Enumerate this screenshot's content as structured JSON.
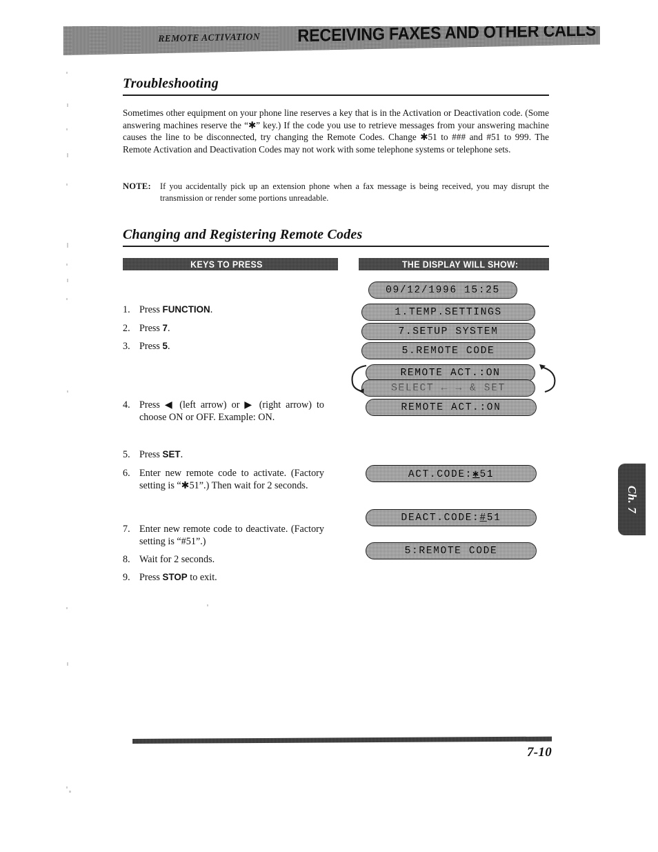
{
  "header": {
    "left": "REMOTE ACTIVATION",
    "right": "RECEIVING FAXES AND OTHER CALLS"
  },
  "sections": {
    "troubleshooting": {
      "title": "Troubleshooting",
      "paragraph": "Sometimes other equipment on your phone line reserves a key that is in the Activation or Deactivation code. (Some answering machines reserve the “✱” key.) If the code you use to retrieve messages from your answering machine causes the line to be disconnected, try changing the Remote Codes. Change ✱51 to ### and #51 to 999. The Remote Activation and Deactivation Codes may not work with some telephone systems or telephone sets.",
      "note_label": "NOTE:",
      "note_text": "If you accidentally pick up an extension phone when a fax message is being received, you may disrupt the transmission or render some portions unreadable."
    },
    "changing": {
      "title": "Changing and Registering Remote Codes"
    }
  },
  "table": {
    "col_keys_header": "KEYS TO PRESS",
    "col_display_header": "THE DISPLAY WILL SHOW:"
  },
  "steps": [
    {
      "num": "1.",
      "pre": "Press ",
      "key": "FUNCTION",
      "post": "."
    },
    {
      "num": "2.",
      "pre": "Press ",
      "key": "7",
      "post": "."
    },
    {
      "num": "3.",
      "pre": "Press ",
      "key": "5",
      "post": "."
    },
    {
      "num": "4.",
      "text": "Press ◀ (left arrow) or ▶ (right arrow) to choose ON or OFF. Example: ON."
    },
    {
      "num": "5.",
      "pre": "Press ",
      "key": "SET",
      "post": "."
    },
    {
      "num": "6.",
      "text": "Enter new remote code to activate. (Factory setting is “✱51”.) Then wait for 2 seconds."
    },
    {
      "num": "7.",
      "text": "Enter new remote code to deactivate. (Factory setting is “#51”.)"
    },
    {
      "num": "8.",
      "text": "Wait for 2 seconds."
    },
    {
      "num": "9.",
      "pre": "Press ",
      "key": "STOP",
      "post": " to exit."
    }
  ],
  "displays": [
    {
      "text": "09/12/1996 15:25"
    },
    {
      "text": "1.TEMP.SETTINGS"
    },
    {
      "text": "7.SETUP SYSTEM"
    },
    {
      "text": "5.REMOTE CODE"
    },
    {
      "text": "REMOTE ACT.:ON"
    },
    {
      "text": "SELECT ← → & SET"
    },
    {
      "text": "REMOTE ACT.:ON"
    },
    {
      "text": "ACT.CODE:✱51"
    },
    {
      "text": "DEACT.CODE:#51"
    },
    {
      "text": "5:REMOTE CODE"
    }
  ],
  "chapter_tab": "Ch. 7",
  "footer": {
    "page_number": "7-10"
  }
}
